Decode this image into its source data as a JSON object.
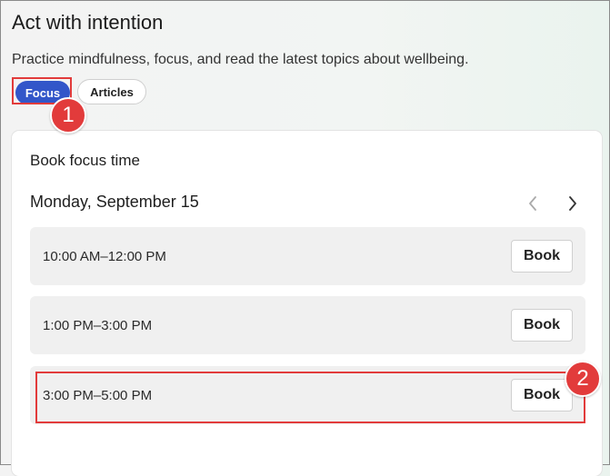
{
  "header": {
    "title": "Act with intention",
    "subtitle": "Practice mindfulness, focus, and read the latest topics about wellbeing."
  },
  "tabs": [
    {
      "label": "Focus",
      "selected": true
    },
    {
      "label": "Articles",
      "selected": false
    }
  ],
  "annotations": {
    "badge1": "1",
    "badge2": "2"
  },
  "card": {
    "title": "Book focus time",
    "date": "Monday, September 15",
    "slots": [
      {
        "time": "10:00 AM–12:00 PM",
        "button": "Book"
      },
      {
        "time": "1:00 PM–3:00 PM",
        "button": "Book"
      },
      {
        "time": "3:00 PM–5:00 PM",
        "button": "Book"
      }
    ]
  },
  "icons": {
    "prev": "chevron-left-icon",
    "next": "chevron-right-icon"
  },
  "colors": {
    "accent": "#3256c9",
    "annotation": "#e23b3b"
  }
}
